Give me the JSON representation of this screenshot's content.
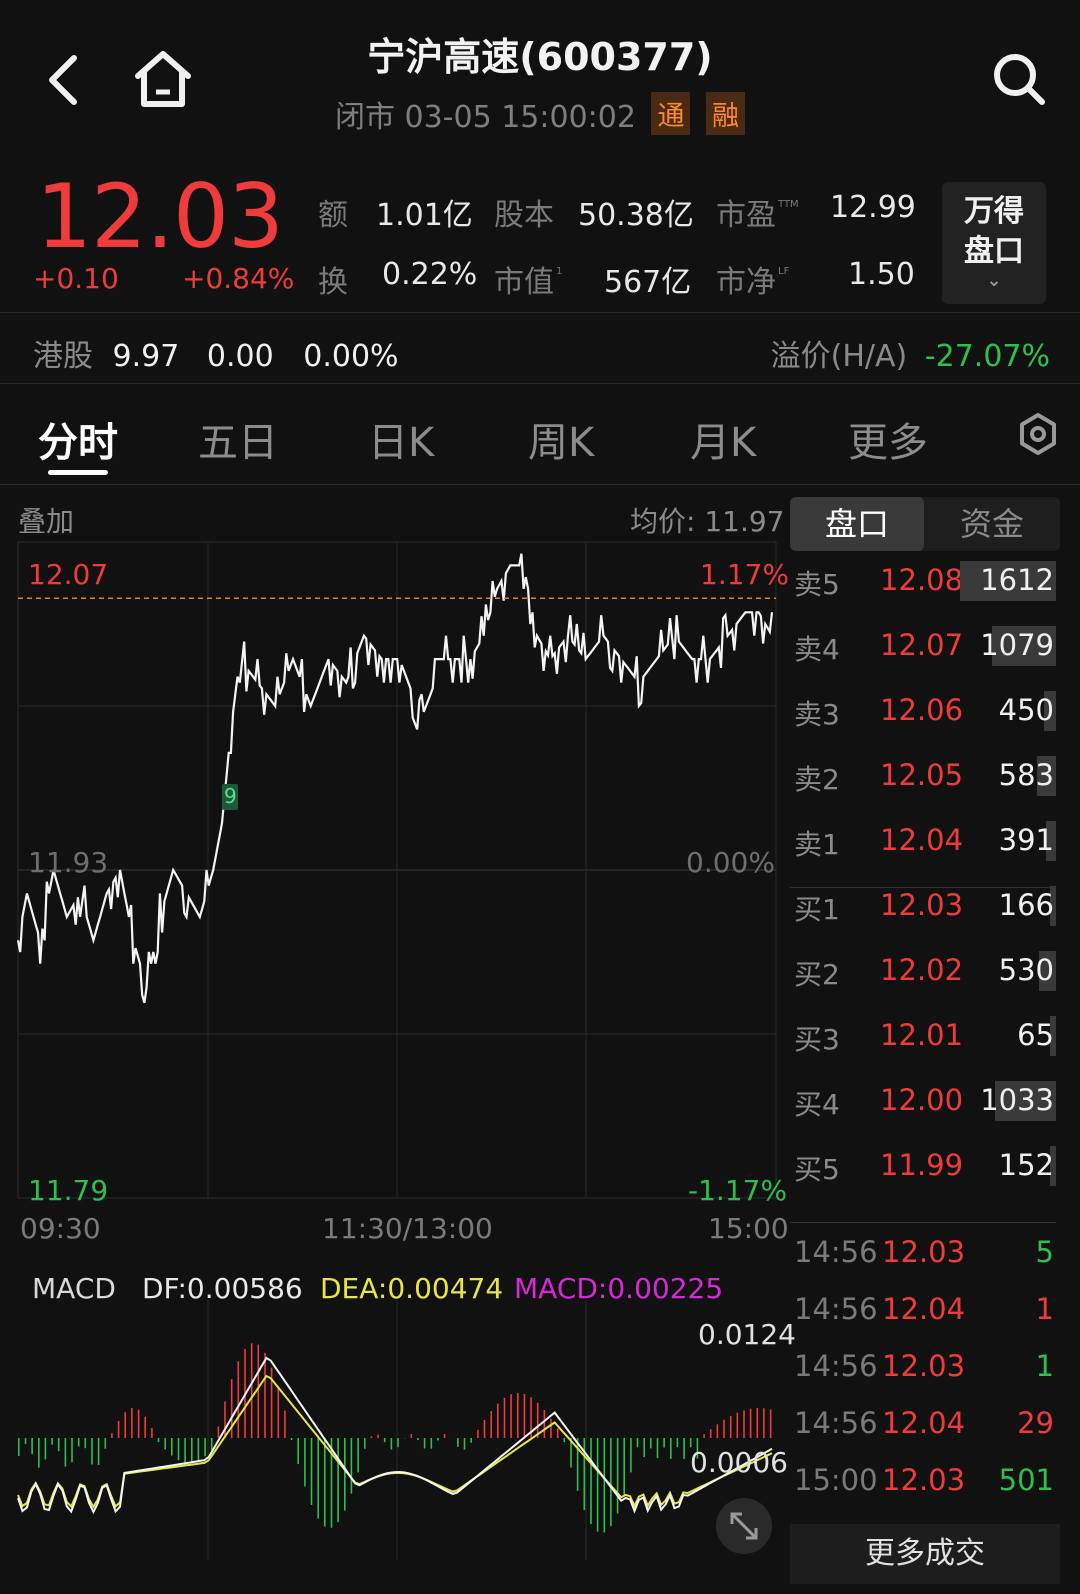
{
  "header": {
    "title": "宁沪高速(600377)",
    "status": "闭市 03-05 15:00:02",
    "tag_tong": "通",
    "tag_rong": "融"
  },
  "quote": {
    "price": "12.03",
    "change": "+0.10",
    "change_pct": "+0.84%",
    "amount_label": "额",
    "amount": "1.01亿",
    "share_label": "股本",
    "share": "50.38亿",
    "pe_label": "市盈",
    "pe_sup": "TTM",
    "pe": "12.99",
    "turnover_label": "换",
    "turnover": "0.22%",
    "mktcap_label": "市值",
    "mktcap_sup": "1",
    "mktcap": "567亿",
    "pb_label": "市净",
    "pb_sup": "LF",
    "pb": "1.50",
    "wind_line1": "万得",
    "wind_line2": "盘口"
  },
  "hk": {
    "label": "港股",
    "price": "9.97",
    "change": "0.00",
    "change_pct": "0.00%",
    "premium_label": "溢价(H/A)",
    "premium": "-27.07%"
  },
  "tabs": [
    "分时",
    "五日",
    "日K",
    "周K",
    "月K",
    "更多"
  ],
  "chart": {
    "overlay_label": "叠加",
    "avg_price_label": "均价: 11.97",
    "max": "12.07",
    "max_pct": "1.17%",
    "mid": "11.93",
    "mid_pct": "0.00%",
    "min": "11.79",
    "min_pct": "-1.17%",
    "time_start": "09:30",
    "time_mid": "11:30/13:00",
    "time_end": "15:00",
    "marker": "9"
  },
  "macd": {
    "title": "MACD",
    "df": "DF:0.00586",
    "dea": "DEA:0.00474",
    "macd": "MACD:0.00225",
    "top_value": "0.0124",
    "zero_value": "0.0006"
  },
  "chart_data": {
    "type": "line",
    "price_axis": {
      "min": 11.79,
      "max": 12.07,
      "prev_close": 11.93
    },
    "avg_price": 11.97,
    "last_price": 12.03
  },
  "panel": {
    "tab_pankou": "盘口",
    "tab_fund": "资金",
    "asks": [
      {
        "label": "卖5",
        "price": "12.08",
        "vol": "1612",
        "share": 1.0
      },
      {
        "label": "卖4",
        "price": "12.07",
        "vol": "1079",
        "share": 0.67
      },
      {
        "label": "卖3",
        "price": "12.06",
        "vol": "450",
        "share": 0.13
      },
      {
        "label": "卖2",
        "price": "12.05",
        "vol": "583",
        "share": 0.2
      },
      {
        "label": "卖1",
        "price": "12.04",
        "vol": "391",
        "share": 0.1
      }
    ],
    "bids": [
      {
        "label": "买1",
        "price": "12.03",
        "vol": "166",
        "share": 0.05
      },
      {
        "label": "买2",
        "price": "12.02",
        "vol": "530",
        "share": 0.18
      },
      {
        "label": "买3",
        "price": "12.01",
        "vol": "65",
        "share": 0.02
      },
      {
        "label": "买4",
        "price": "12.00",
        "vol": "1033",
        "share": 0.64
      },
      {
        "label": "买5",
        "price": "11.99",
        "vol": "152",
        "share": 0.05
      }
    ],
    "trades": [
      {
        "time": "14:56",
        "price": "12.03",
        "vol": "5",
        "dir": "sell"
      },
      {
        "time": "14:56",
        "price": "12.04",
        "vol": "1",
        "dir": "buy"
      },
      {
        "time": "14:56",
        "price": "12.03",
        "vol": "1",
        "dir": "sell"
      },
      {
        "time": "14:56",
        "price": "12.04",
        "vol": "29",
        "dir": "buy"
      },
      {
        "time": "15:00",
        "price": "12.03",
        "vol": "501",
        "dir": "sell"
      }
    ],
    "more_trades": "更多成交"
  },
  "colors": {
    "up": "#ee3b3b",
    "down": "#2fbf4f",
    "bg": "#111111"
  },
  "icons": [
    "back-icon",
    "home-icon",
    "search-icon",
    "gear-icon",
    "expand-icon"
  ]
}
